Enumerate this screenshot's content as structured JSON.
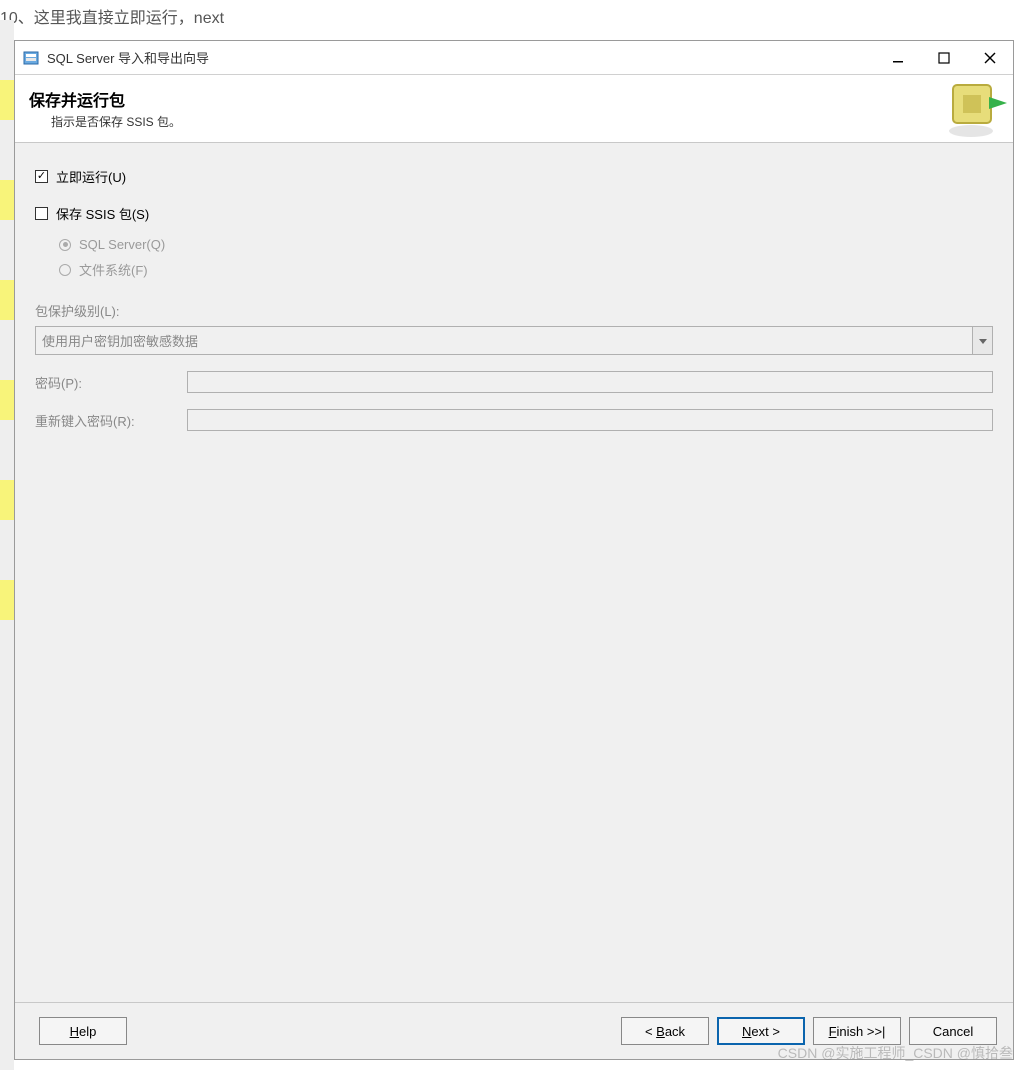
{
  "caption": "10、这里我直接立即运行，next",
  "window": {
    "title": "SQL Server 导入和导出向导",
    "controls": {
      "minimize": "minimize",
      "maximize": "maximize",
      "close": "close"
    }
  },
  "banner": {
    "heading": "保存并运行包",
    "subheading": "指示是否保存 SSIS 包。"
  },
  "form": {
    "run_now": {
      "label": "立即运行(U)",
      "checked": true
    },
    "save_ssis": {
      "label": "保存 SSIS 包(S)",
      "checked": false
    },
    "radio_sql": {
      "label": "SQL Server(Q)"
    },
    "radio_fs": {
      "label": "文件系统(F)"
    },
    "protection_label": "包保护级别(L):",
    "protection_value": "使用用户密钥加密敏感数据",
    "password_label": "密码(P):",
    "repassword_label": "重新键入密码(R):"
  },
  "buttons": {
    "help": "Help",
    "back": "< Back",
    "next": "Next >",
    "finish": "Finish >>|",
    "cancel": "Cancel"
  },
  "watermark": "CSDN @实施工程师_CSDN @慎拾叁"
}
